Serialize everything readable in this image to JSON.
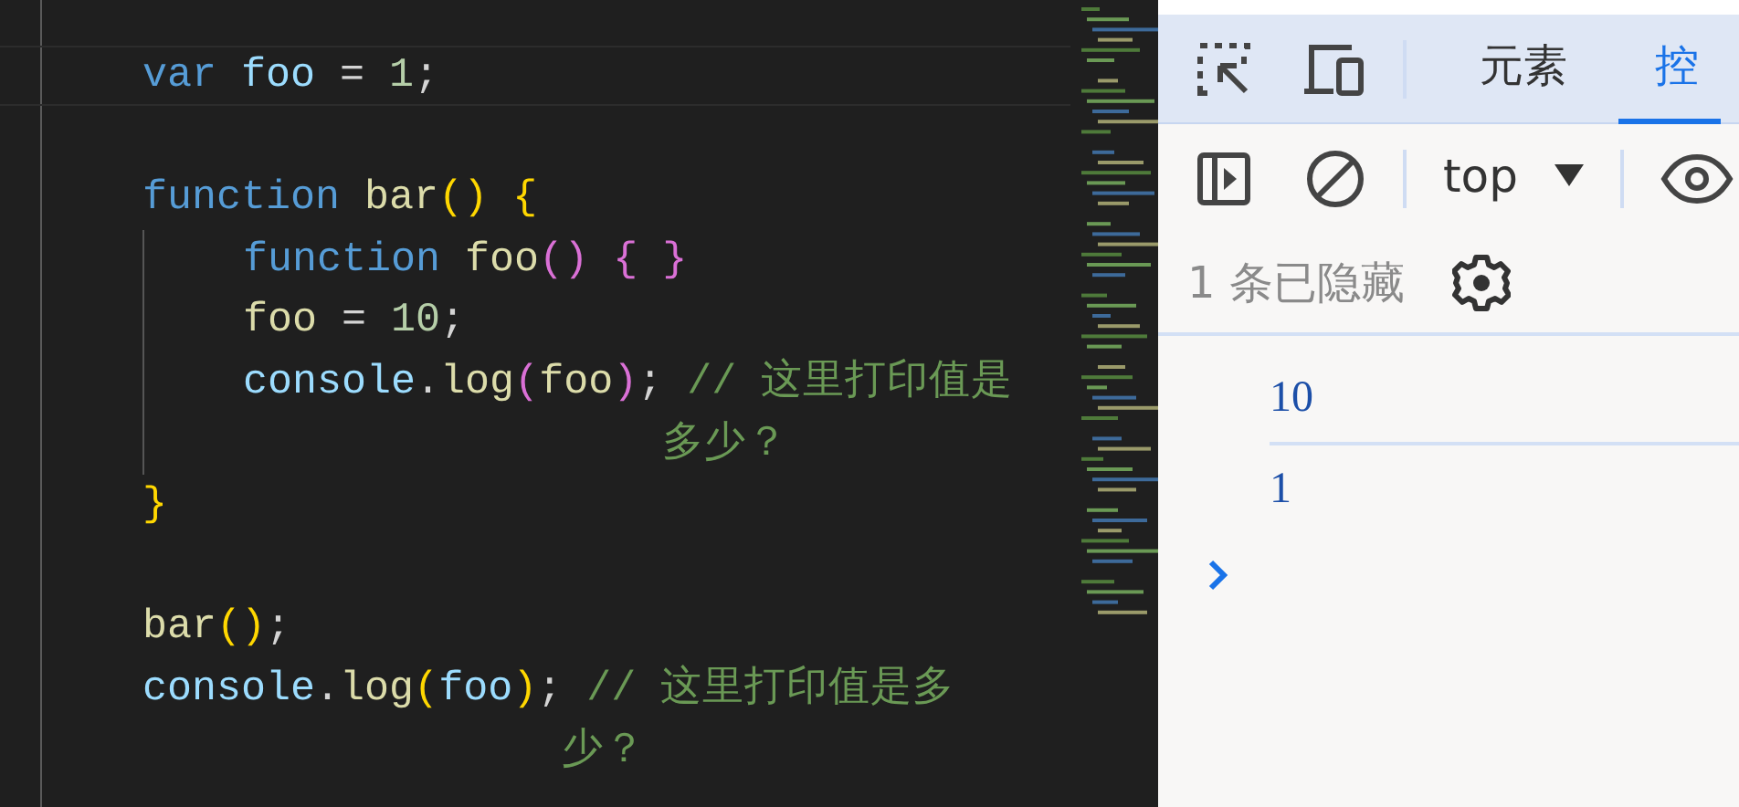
{
  "editor": {
    "lines": [
      {
        "kind": "code",
        "tokens": [
          {
            "kind": "keyword",
            "text": "var "
          },
          {
            "kind": "variable",
            "text": "foo"
          },
          {
            "kind": "plain",
            "text": " = "
          },
          {
            "kind": "number",
            "text": "1"
          },
          {
            "kind": "plain",
            "text": ";"
          }
        ]
      },
      {
        "kind": "blank"
      },
      {
        "kind": "code",
        "tokens": [
          {
            "kind": "keyword",
            "text": "function "
          },
          {
            "kind": "function",
            "text": "bar"
          },
          {
            "kind": "bracket",
            "text": "(",
            "color": "#ffd700"
          },
          {
            "kind": "bracket",
            "text": ")",
            "color": "#ffd700"
          },
          {
            "kind": "bracket",
            "text": " {",
            "color": "#ffd700"
          }
        ],
        "children": [
          {
            "kind": "code",
            "tokens": [
              {
                "kind": "keyword",
                "text": "function "
              },
              {
                "kind": "function",
                "text": "foo"
              },
              {
                "kind": "bracket",
                "text": "(",
                "color": "#da70d6"
              },
              {
                "kind": "bracket",
                "text": ")",
                "color": "#da70d6"
              },
              {
                "kind": "bracket",
                "text": " {",
                "color": "#da70d6"
              },
              {
                "kind": "bracket",
                "text": " }",
                "color": "#da70d6"
              }
            ]
          },
          {
            "kind": "code",
            "tokens": [
              {
                "kind": "function",
                "text": "foo"
              },
              {
                "kind": "plain",
                "text": " = "
              },
              {
                "kind": "number",
                "text": "10"
              },
              {
                "kind": "plain",
                "text": ";"
              }
            ]
          },
          {
            "kind": "code",
            "tokens": [
              {
                "kind": "variable",
                "text": "console"
              },
              {
                "kind": "plain",
                "text": "."
              },
              {
                "kind": "function",
                "text": "log"
              },
              {
                "kind": "bracket",
                "text": "(",
                "color": "#da70d6"
              },
              {
                "kind": "function",
                "text": "foo"
              },
              {
                "kind": "bracket",
                "text": ")",
                "color": "#da70d6"
              },
              {
                "kind": "plain",
                "text": ";"
              },
              {
                "kind": "comment",
                "text": " // 这里打印值是多少？"
              }
            ]
          }
        ]
      },
      {
        "kind": "code",
        "tokens": [
          {
            "kind": "bracket",
            "text": "}",
            "color": "#ffd700"
          }
        ]
      },
      {
        "kind": "blank"
      },
      {
        "kind": "code",
        "tokens": [
          {
            "kind": "function",
            "text": "bar"
          },
          {
            "kind": "bracket",
            "text": "(",
            "color": "#ffd700"
          },
          {
            "kind": "bracket",
            "text": ")",
            "color": "#ffd700"
          },
          {
            "kind": "plain",
            "text": ";"
          }
        ]
      },
      {
        "kind": "code",
        "tokens": [
          {
            "kind": "variable",
            "text": "console"
          },
          {
            "kind": "plain",
            "text": "."
          },
          {
            "kind": "function",
            "text": "log"
          },
          {
            "kind": "bracket",
            "text": "(",
            "color": "#ffd700"
          },
          {
            "kind": "variable",
            "text": "foo"
          },
          {
            "kind": "bracket",
            "text": ")",
            "color": "#ffd700"
          },
          {
            "kind": "plain",
            "text": ";"
          },
          {
            "kind": "comment",
            "text": " // 这里打印值是多少？"
          }
        ]
      }
    ]
  },
  "devtools": {
    "tabs": [
      {
        "label": "元素",
        "selected": false
      },
      {
        "label": "控",
        "selected": true
      }
    ],
    "context": "top",
    "hidden_notice": "1 条已隐藏",
    "messages": [
      {
        "text": "10"
      },
      {
        "text": "1"
      }
    ]
  }
}
